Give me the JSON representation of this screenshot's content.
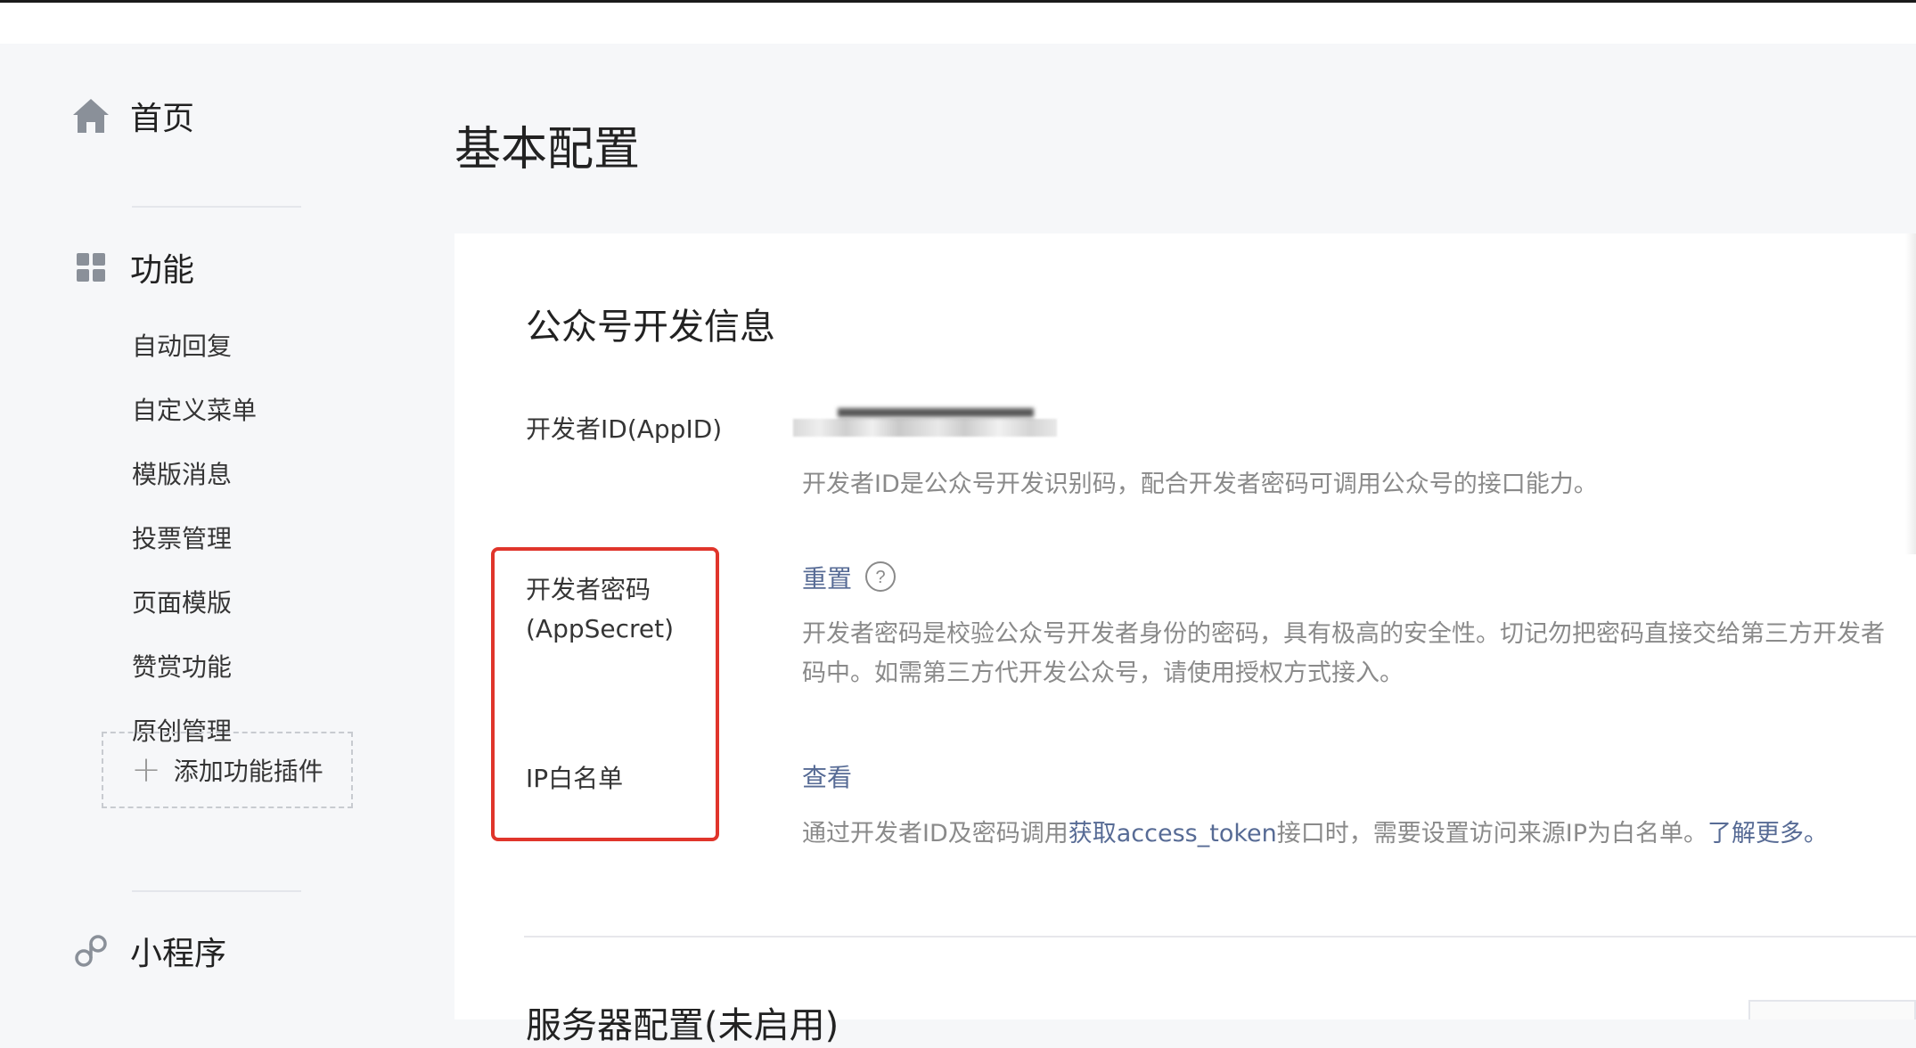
{
  "sidebar": {
    "home": {
      "label": "首页",
      "icon": "home-icon"
    },
    "features": {
      "label": "功能",
      "icon": "grid-icon",
      "items": [
        "自动回复",
        "自定义菜单",
        "模版消息",
        "投票管理",
        "页面模版",
        "赞赏功能",
        "原创管理"
      ],
      "add_plugin": "添加功能插件"
    },
    "miniprogram": {
      "label": "小程序",
      "icon": "link-icon"
    }
  },
  "main": {
    "page_title": "基本配置",
    "section_title": "公众号开发信息",
    "fields": {
      "appid": {
        "label": "开发者ID(AppID)",
        "value_masked": true,
        "desc": "开发者ID是公众号开发识别码，配合开发者密码可调用公众号的接口能力。"
      },
      "secret": {
        "label_line1": "开发者密码",
        "label_line2": "(AppSecret)",
        "action": "重置",
        "desc_line1": "开发者密码是校验公众号开发者身份的密码，具有极高的安全性。切记勿把密码直接交给第三方开发者",
        "desc_line2": "码中。如需第三方代开发公众号，请使用授权方式接入。"
      },
      "ip_whitelist": {
        "label": "IP白名单",
        "action": "查看",
        "desc_prefix": "通过开发者ID及密码调用",
        "desc_link1": "获取access_token",
        "desc_middle": "接口时，需要设置访问来源IP为白名单。",
        "desc_link2": "了解更多。"
      }
    },
    "next_section_title": "服务器配置(未启用)"
  },
  "colors": {
    "link": "#576b95",
    "highlight": "#e0352b",
    "muted": "#8a8a8a"
  }
}
